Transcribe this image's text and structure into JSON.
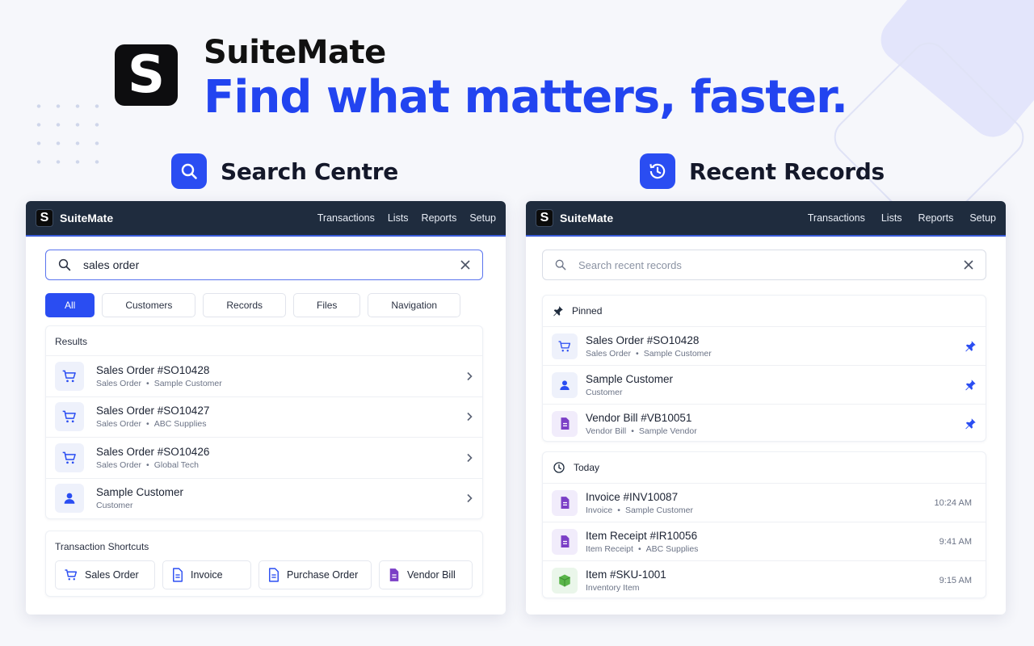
{
  "hero": {
    "logo_letter": "S",
    "brand": "SuiteMate",
    "tagline": "Find what matters, faster."
  },
  "colors": {
    "accent": "#2a4df2",
    "navbar": "#1f2c3e",
    "purple": "#7b3fc6",
    "green": "#5ab54a"
  },
  "search_section": {
    "title": "Search Centre",
    "icon": "search-icon"
  },
  "recent_section": {
    "title": "Recent Records",
    "icon": "clock-history-icon"
  },
  "navbar": {
    "logo_letter": "S",
    "brand": "SuiteMate",
    "links": [
      "Transactions",
      "Lists",
      "Reports",
      "Setup"
    ]
  },
  "search_panel": {
    "query": "sales order",
    "filters": [
      "All",
      "Customers",
      "Records",
      "Files",
      "Navigation"
    ],
    "active_filter": "All",
    "results_label": "Results",
    "results": [
      {
        "title": "Sales Order #SO10428",
        "type": "Sales Order",
        "entity": "Sample Customer",
        "icon": "cart-icon"
      },
      {
        "title": "Sales Order #SO10427",
        "type": "Sales Order",
        "entity": "ABC Supplies",
        "icon": "cart-icon"
      },
      {
        "title": "Sales Order #SO10426",
        "type": "Sales Order",
        "entity": "Global Tech",
        "icon": "cart-icon"
      },
      {
        "title": "Sample Customer",
        "type": "Customer",
        "entity": "",
        "icon": "person-icon"
      }
    ],
    "shortcuts_label": "Transaction Shortcuts",
    "shortcuts": [
      {
        "label": "Sales Order",
        "icon": "cart-icon"
      },
      {
        "label": "Invoice",
        "icon": "document-icon"
      },
      {
        "label": "Purchase Order",
        "icon": "document-icon"
      },
      {
        "label": "Vendor Bill",
        "icon": "document-purple-icon"
      }
    ]
  },
  "recent_panel": {
    "placeholder": "Search recent records",
    "pinned_label": "Pinned",
    "pinned": [
      {
        "title": "Sales Order #SO10428",
        "type": "Sales Order",
        "entity": "Sample Customer",
        "icon": "cart-icon"
      },
      {
        "title": "Sample Customer",
        "type": "Customer",
        "entity": "",
        "icon": "person-icon"
      },
      {
        "title": "Vendor Bill #VB10051",
        "type": "Vendor Bill",
        "entity": "Sample Vendor",
        "icon": "document-purple-icon"
      }
    ],
    "today_label": "Today",
    "today": [
      {
        "title": "Invoice #INV10087",
        "type": "Invoice",
        "entity": "Sample Customer",
        "time": "10:24 AM",
        "icon": "document-purple-icon"
      },
      {
        "title": "Item Receipt #IR10056",
        "type": "Item Receipt",
        "entity": "ABC Supplies",
        "time": "9:41 AM",
        "icon": "document-purple-icon"
      },
      {
        "title": "Item #SKU-1001",
        "type": "Inventory Item",
        "entity": "",
        "time": "9:15 AM",
        "icon": "box-icon"
      }
    ]
  }
}
